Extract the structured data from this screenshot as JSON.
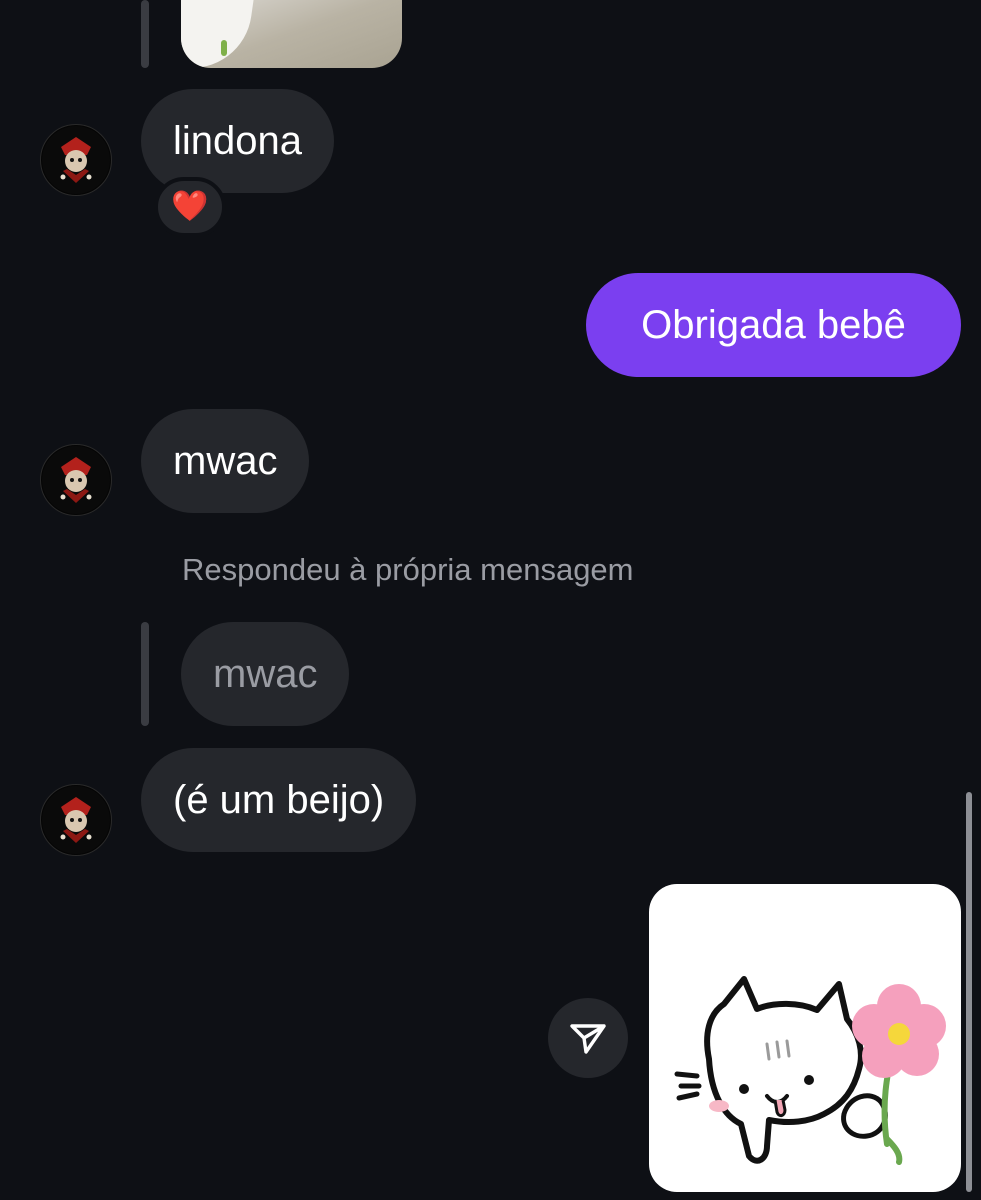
{
  "conversation": {
    "messages": [
      {
        "sender": "other",
        "text": "lindona",
        "reaction": "❤️"
      },
      {
        "sender": "me",
        "text": "Obrigada bebê"
      },
      {
        "sender": "other",
        "text": "mwac"
      },
      {
        "sender": "other",
        "reply_label": "Respondeu à própria mensagem",
        "quoted_text": "mwac",
        "text": "(é um beijo)"
      },
      {
        "sender": "me",
        "type": "sticker",
        "sticker_icon": "cat-with-flower-sticker"
      }
    ]
  },
  "icons": {
    "share": "send-icon",
    "avatar": "profile-avatar-icon",
    "reaction": "heart-icon"
  },
  "colors": {
    "background": "#0e1015",
    "incoming_bubble": "#25272c",
    "outgoing_bubble": "#7b3ff0",
    "muted_text": "#9a9ca3"
  }
}
